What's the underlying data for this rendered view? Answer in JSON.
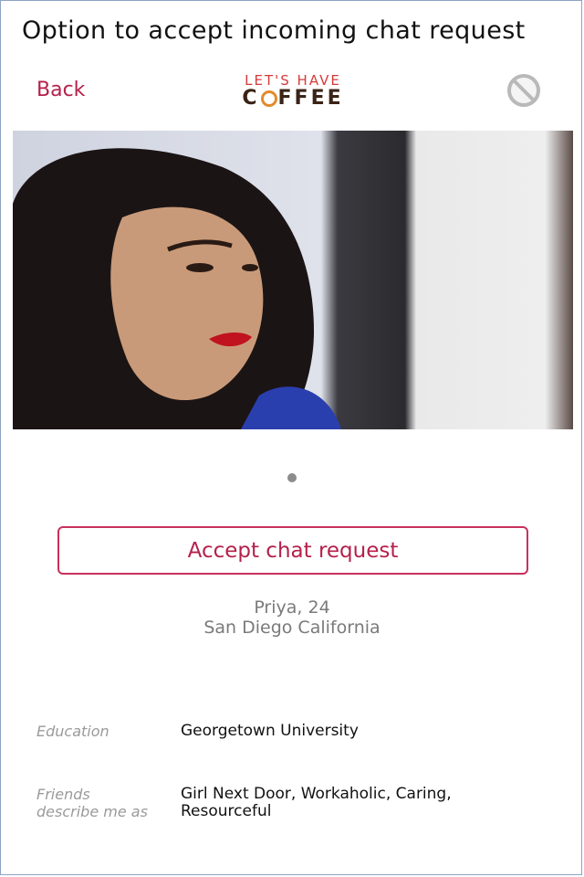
{
  "caption": "Option to accept incoming chat request",
  "nav": {
    "back_label": "Back",
    "logo_top": "LET'S HAVE",
    "logo_bottom_left": "C",
    "logo_bottom_right": "FFEE",
    "block_icon": "block-icon"
  },
  "profile": {
    "photo_indicator_count": 1,
    "accept_label": "Accept chat request",
    "name_age": "Priya, 24",
    "location": "San Diego California"
  },
  "details": [
    {
      "label": "Education",
      "value": "Georgetown University"
    },
    {
      "label_line1": "Friends",
      "label_line2": "describe me as",
      "value_line1": "Girl Next Door, Workaholic, Caring,",
      "value_line2": "Resourceful"
    }
  ],
  "colors": {
    "accent": "#b5214b",
    "logo_red": "#d63b3b",
    "logo_brown": "#3a2417",
    "logo_orange": "#e38a2a"
  }
}
